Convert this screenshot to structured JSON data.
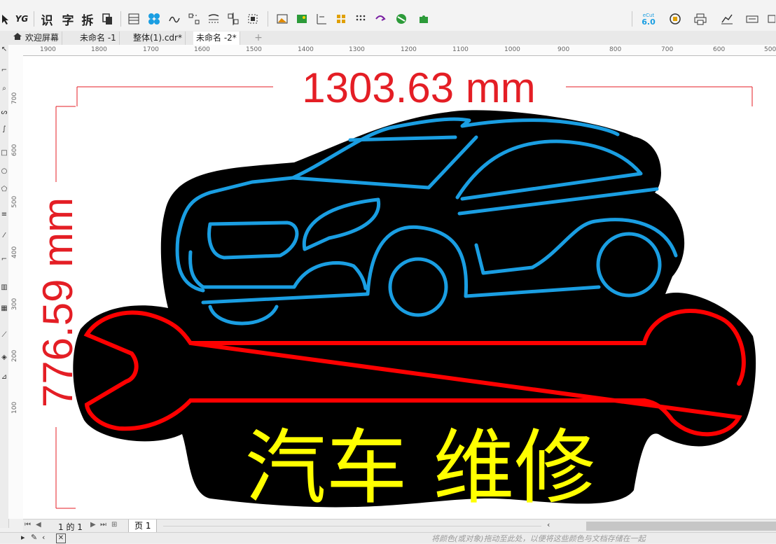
{
  "toolbar": {
    "text_buttons": [
      "识",
      "字",
      "拆"
    ],
    "version_badge": "6.0",
    "version_badge_top": "eCut"
  },
  "tabs": [
    {
      "label": "欢迎屏幕",
      "active": false
    },
    {
      "label": "未命名 -1",
      "active": false
    },
    {
      "label": "整体(1).cdr*",
      "active": false
    },
    {
      "label": "未命名 -2*",
      "active": true
    }
  ],
  "ruler": {
    "h_ticks": [
      "1900",
      "1800",
      "1700",
      "1600",
      "1500",
      "1400",
      "1300",
      "1200",
      "1100",
      "1000",
      "900",
      "800",
      "700",
      "600",
      "500"
    ],
    "v_ticks": [
      "700",
      "600",
      "500",
      "400",
      "300",
      "200",
      "100"
    ]
  },
  "design": {
    "width_dimension": "1303.63 mm",
    "height_dimension": "776.59 mm",
    "sign_text": "汽车 维修",
    "colors": {
      "dimension": "#e41e25",
      "car_outline": "#1a9ee2",
      "wrench_outline": "#ff0000",
      "text": "#ffff00",
      "backing": "#000000"
    }
  },
  "pagebar": {
    "page_indicator": "1 的 1",
    "page_tab": "页 1"
  },
  "status": {
    "hint": "将颜色(或对象)拖动至此处，以便将这些颜色与文档存储在一起"
  }
}
